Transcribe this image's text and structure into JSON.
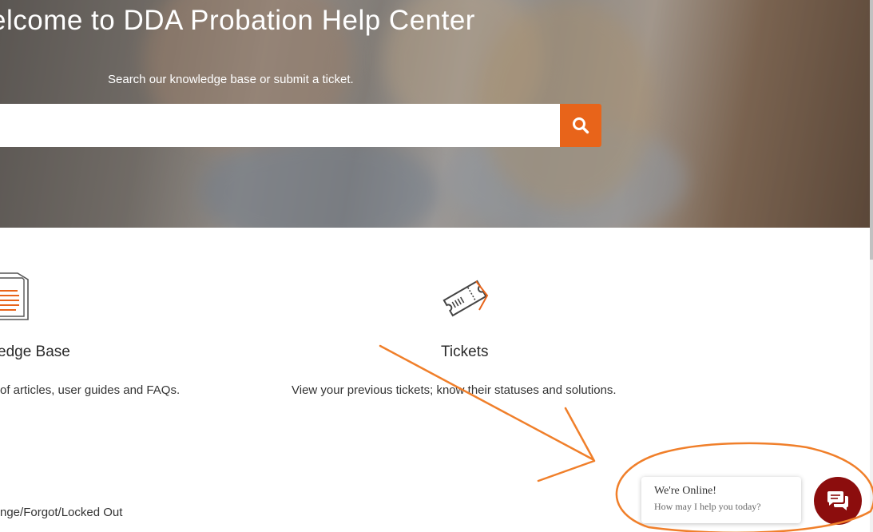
{
  "hero": {
    "title": "elcome to DDA Probation Help Center",
    "subtitle": "Search our knowledge base or submit a ticket.",
    "search_placeholder": ""
  },
  "cards": {
    "knowledge_base": {
      "icon": "documents-icon",
      "title": "edge Base",
      "description": " of articles, user guides and FAQs."
    },
    "tickets": {
      "icon": "ticket-icon",
      "title": "Tickets",
      "description": "View your previous tickets; know their statuses and solutions."
    }
  },
  "links": {
    "password_item": "nge/Forgot/Locked Out"
  },
  "chat": {
    "status": "We're Online!",
    "prompt": "How may I help you today?",
    "icon": "chat-bubbles-icon"
  },
  "colors": {
    "accent": "#e8641a",
    "annotation": "#f07f2a",
    "chat_launcher": "#8c0d0d"
  }
}
